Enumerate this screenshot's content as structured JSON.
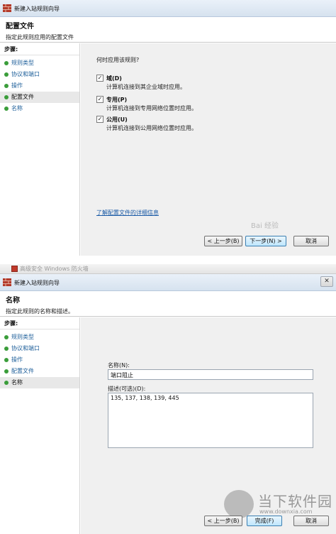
{
  "wizard1": {
    "window_title": "新建入站规则向导",
    "header_title": "配置文件",
    "header_subtitle": "指定此规则应用的配置文件",
    "steps_label": "步骤:",
    "steps": [
      {
        "label": "规则类型",
        "current": false
      },
      {
        "label": "协议和端口",
        "current": false
      },
      {
        "label": "操作",
        "current": false
      },
      {
        "label": "配置文件",
        "current": true
      },
      {
        "label": "名称",
        "current": false
      }
    ],
    "question": "何时应用该规则?",
    "options": [
      {
        "title": "域(D)",
        "description": "计算机连接到其企业域时应用。",
        "checked": true
      },
      {
        "title": "专用(P)",
        "description": "计算机连接到专用网络位置时应用。",
        "checked": true
      },
      {
        "title": "公用(U)",
        "description": "计算机连接到公用网络位置时应用。",
        "checked": true
      }
    ],
    "learn_more_link": "了解配置文件的详细信息",
    "buttons": {
      "back": "< 上一步(B)",
      "next": "下一步(N) >",
      "cancel": "取消"
    },
    "watermark": "Bai 经验"
  },
  "wizard2": {
    "taskbar_text": "高级安全 Windows 防火墙",
    "window_title": "新建入站规则向导",
    "close_glyph": "✕",
    "header_title": "名称",
    "header_subtitle": "指定此规则的名称和描述。",
    "steps_label": "步骤:",
    "steps": [
      {
        "label": "规则类型",
        "current": false
      },
      {
        "label": "协议和端口",
        "current": false
      },
      {
        "label": "操作",
        "current": false
      },
      {
        "label": "配置文件",
        "current": false
      },
      {
        "label": "名称",
        "current": true
      }
    ],
    "name_label": "名称(N):",
    "name_value": "端口阻止",
    "desc_label": "描述(可选)(D):",
    "desc_value": "135, 137, 138, 139, 445",
    "buttons": {
      "back": "< 上一步(B)",
      "finish": "完成(F)",
      "cancel": "取消"
    }
  },
  "watermark_logo": {
    "text": "当下软件园",
    "url": "www.downxia.com"
  },
  "check_glyph": "✓",
  "colors": {
    "link": "#1a5aa6",
    "step_dot": "#3a9d3a",
    "content_bg": "#f0f0f0"
  }
}
